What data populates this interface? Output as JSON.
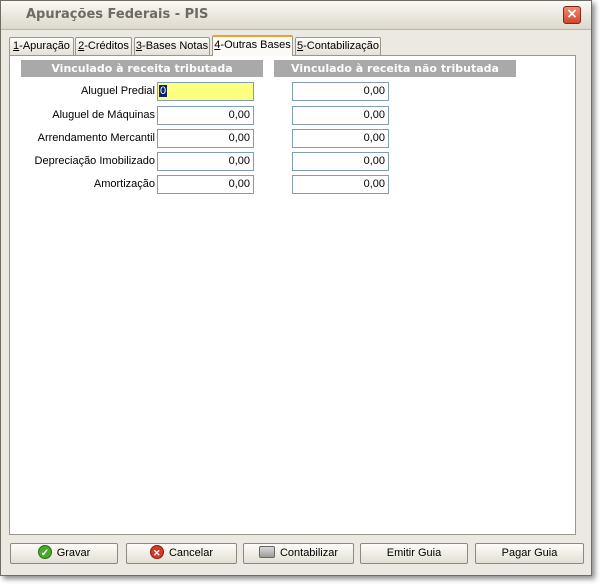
{
  "window": {
    "title": "Apurações Federais - PIS",
    "close_glyph": "×"
  },
  "tabs": [
    {
      "key": "1",
      "label": "-Apuração",
      "active": false
    },
    {
      "key": "2",
      "label": "-Créditos",
      "active": false
    },
    {
      "key": "3",
      "label": "-Bases Notas",
      "active": false
    },
    {
      "key": "4",
      "label": "-Outras Bases",
      "active": true
    },
    {
      "key": "5",
      "label": "-Contabilização",
      "active": false
    }
  ],
  "columns": {
    "taxed": "Vinculado à receita tributada",
    "untaxed": "Vinculado à receita não tributada"
  },
  "rows": [
    {
      "label": "Aluguel Predial",
      "taxed": "0",
      "untaxed": "0,00"
    },
    {
      "label": "Aluguel de Máquinas",
      "taxed": "0,00",
      "untaxed": "0,00"
    },
    {
      "label": "Arrendamento Mercantil",
      "taxed": "0,00",
      "untaxed": "0,00"
    },
    {
      "label": "Depreciação Imobilizado",
      "taxed": "0,00",
      "untaxed": "0,00"
    },
    {
      "label": "Amortização",
      "taxed": "0,00",
      "untaxed": "0,00"
    }
  ],
  "buttons": {
    "save": "Gravar",
    "cancel": "Cancelar",
    "post": "Contabilizar",
    "issue": "Emitir Guia",
    "pay": "Pagar Guia"
  },
  "icons": {
    "save": "check-icon",
    "cancel": "cancel-icon",
    "post": "calculator-icon",
    "close": "close-icon"
  },
  "colors": {
    "focus_field": "#ffff80",
    "header_bar": "#a9a9a9",
    "active_tab_accent": "#e6a233",
    "close_button": "#d8442c"
  }
}
